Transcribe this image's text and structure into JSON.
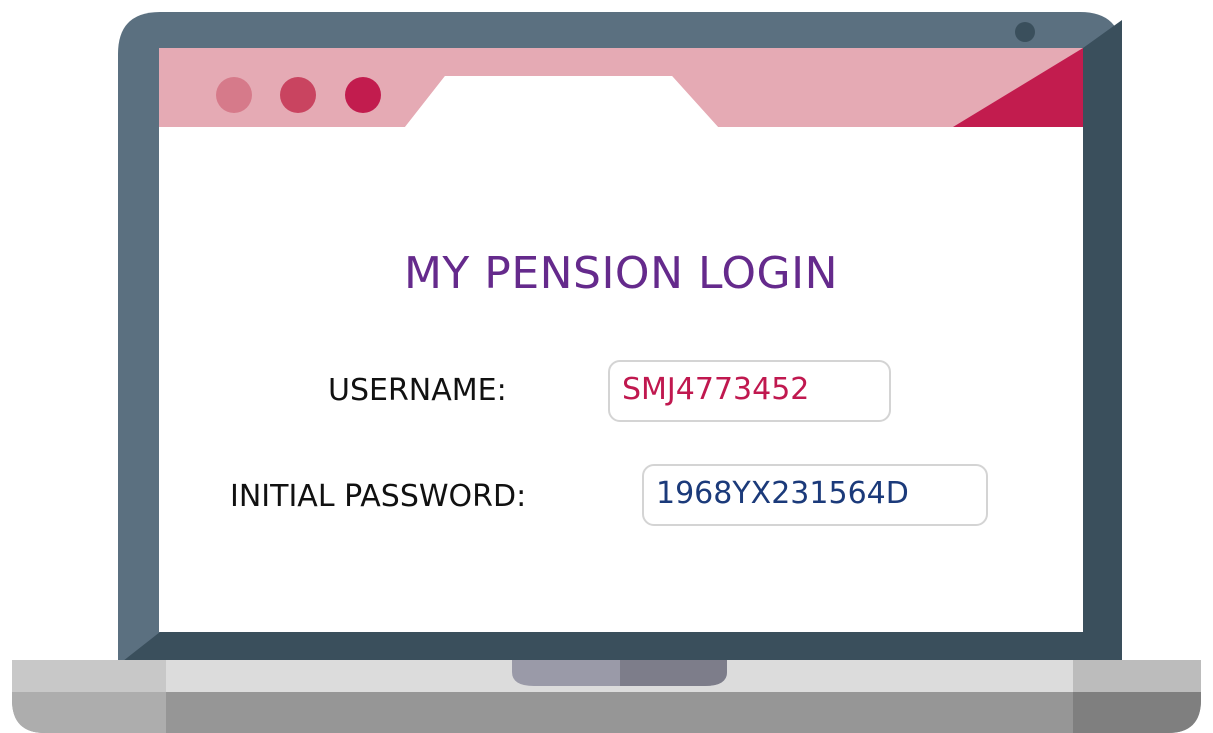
{
  "page": {
    "title": "MY PENSION LOGIN"
  },
  "form": {
    "username_label": "USERNAME:",
    "username_value": "SMJ4773452",
    "password_label": "INITIAL PASSWORD:",
    "password_value": "1968YX231564D"
  },
  "colors": {
    "title": "#652a8c",
    "username_value": "#c0184f",
    "password_value": "#1b3a7a",
    "bezel": "#5b7080",
    "bezel_dark": "#3a4f5c",
    "browser_bar": "#e5aab4",
    "accent": "#c21c4e",
    "base": "#dcdcdc",
    "base_dark": "#969696"
  },
  "icons": {
    "window_dots": [
      "dot-light-icon",
      "dot-medium-icon",
      "dot-dark-icon"
    ],
    "camera": "webcam-icon"
  }
}
